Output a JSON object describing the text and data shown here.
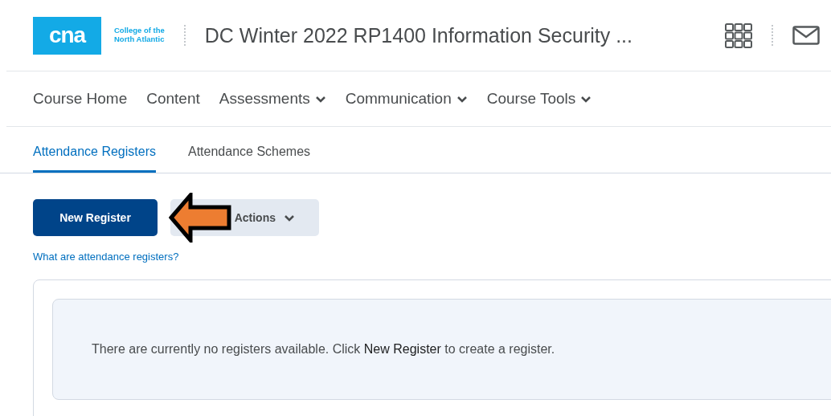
{
  "header": {
    "logo": {
      "mark": "cna",
      "name_line_1": "College of the",
      "name_line_2": "North Atlantic"
    },
    "course_title": "DC Winter 2022 RP1400 Information Security ..."
  },
  "nav": [
    {
      "label": "Course Home",
      "kind": "link"
    },
    {
      "label": "Content",
      "kind": "link"
    },
    {
      "label": "Assessments",
      "kind": "menu"
    },
    {
      "label": "Communication",
      "kind": "menu"
    },
    {
      "label": "Course Tools",
      "kind": "menu"
    }
  ],
  "tabs": [
    {
      "label": "Attendance Registers",
      "selected": true
    },
    {
      "label": "Attendance Schemes",
      "selected": false
    }
  ],
  "actions": {
    "primary": "New Register",
    "more": "Actions"
  },
  "help_link": "What are attendance registers?",
  "empty_message": "There are currently no registers available. Click **New Register** to create a register."
}
